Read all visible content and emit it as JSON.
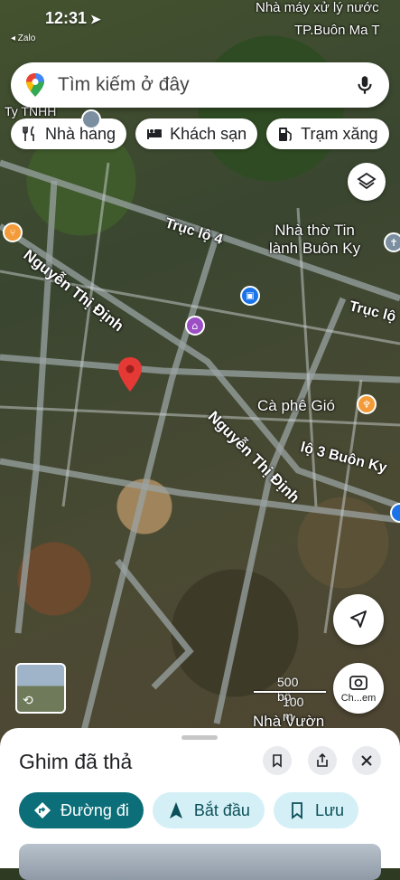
{
  "status_bar": {
    "time": "12:31",
    "back_app": "◂ Zalo"
  },
  "search": {
    "placeholder": "Tìm kiếm ở đây"
  },
  "chips": [
    {
      "label": "Nhà hàng",
      "icon": "restaurant-icon"
    },
    {
      "label": "Khách sạn",
      "icon": "hotel-icon"
    },
    {
      "label": "Trạm xăng",
      "icon": "gas-station-icon"
    }
  ],
  "map_labels": {
    "top_right_1": "Nhà máy xử lý nước",
    "top_right_2": "TP.Buôn Ma T",
    "top_left": "Ty TNHH",
    "church": "Nhà thờ Tin\nlành Buôn Ky",
    "cafe": "Cà phê Gió",
    "nha_vuon": "Nhà Vườn"
  },
  "road_labels": {
    "truc_lo_4": "Trục lộ 4",
    "nguyen_thi_dinh_1": "Nguyễn Thị Định",
    "nguyen_thi_dinh_2": "Nguyễn Thị Định",
    "truc_lo_right": "Trục lộ",
    "lo_3": "lộ 3 Buôn Ky"
  },
  "scale": {
    "feet": "500 bộ",
    "meters": "100 m"
  },
  "photo_button": {
    "label": "Ch...em"
  },
  "sheet": {
    "title": "Ghim đã thả",
    "actions": [
      {
        "label": "Đường đi",
        "icon": "directions-icon"
      },
      {
        "label": "Bắt đầu",
        "icon": "navigation-arrow-icon"
      },
      {
        "label": "Lưu",
        "icon": "bookmark-icon"
      }
    ]
  },
  "colors": {
    "primary": "#0b6e78",
    "secondary": "#d4f0f6",
    "pin": "#e53935"
  }
}
